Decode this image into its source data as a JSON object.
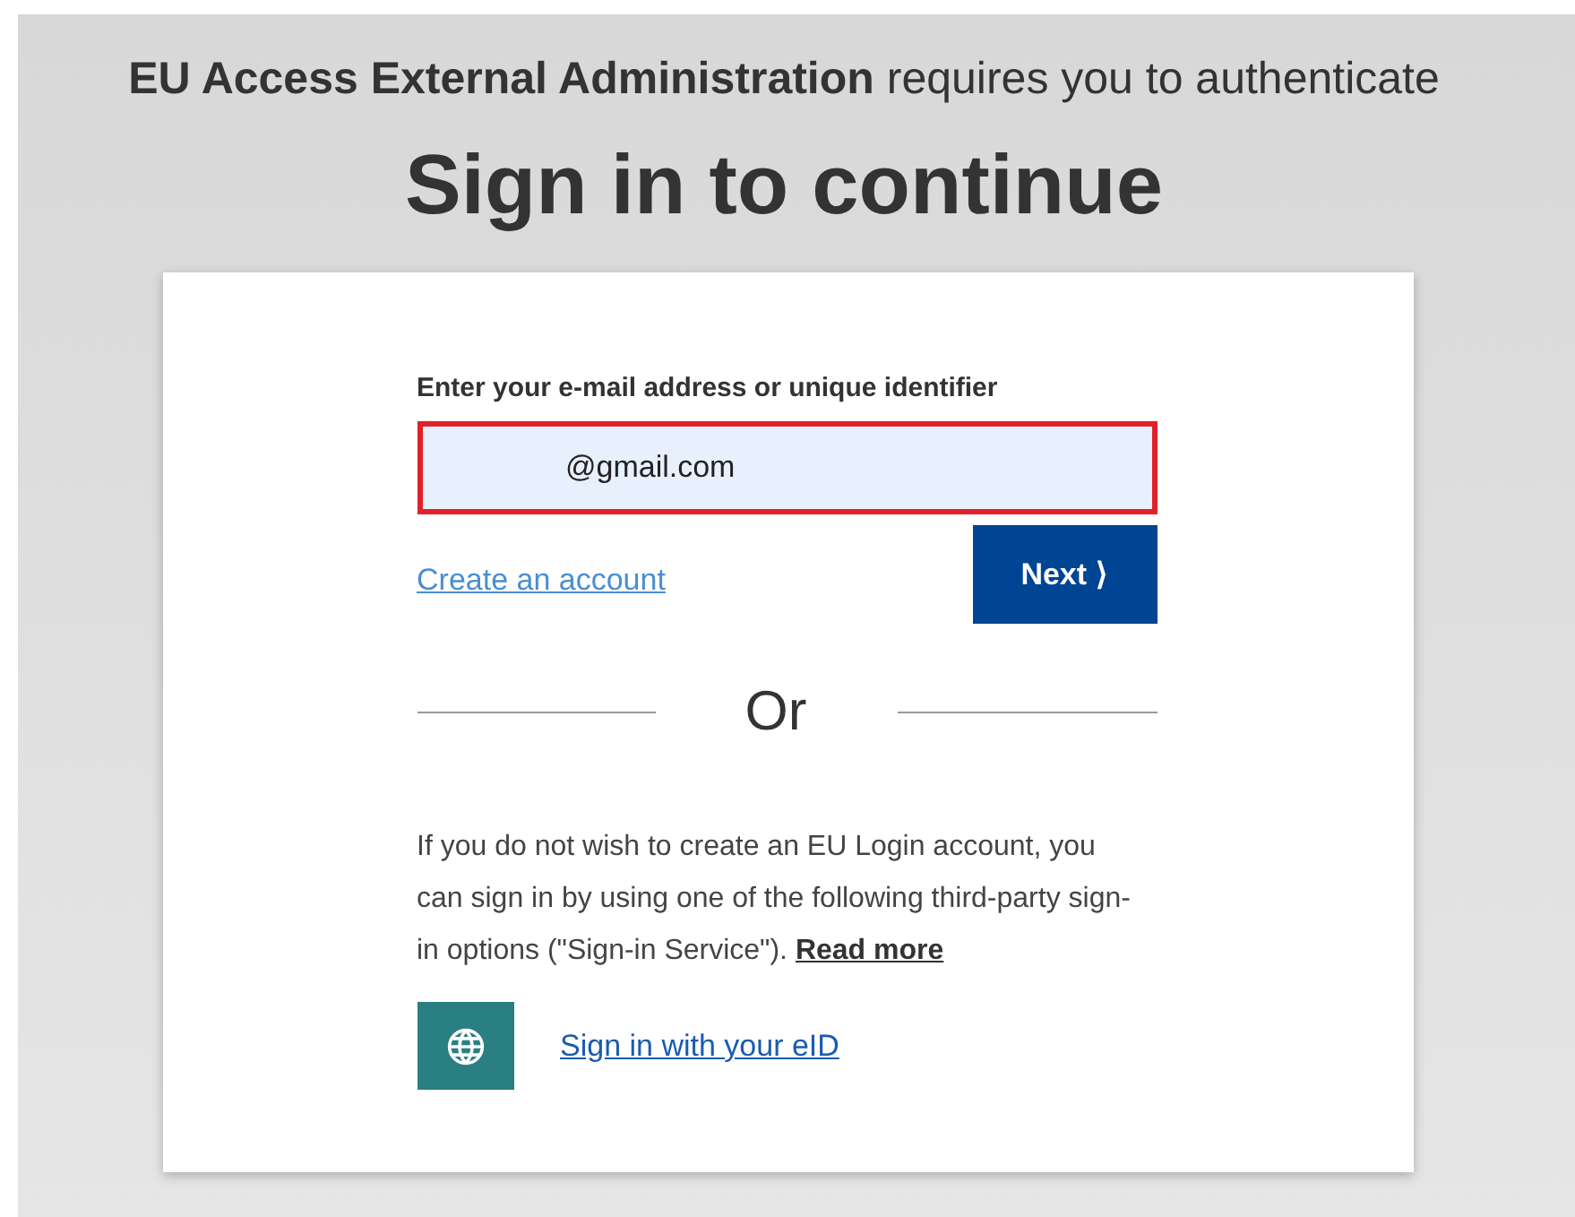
{
  "header": {
    "text": "**EU Access External Administration** requires you to authenticate"
  },
  "title": "Sign in to continue",
  "form": {
    "label": "Enter your e-mail address or unique identifier",
    "value": "@gmail.com",
    "highlighted": true
  },
  "create_account_link": "Create an account",
  "next_button": "Next ⟩",
  "divider_text": "Or",
  "info": {
    "text": "If you do not wish to create an EU Login account, you can sign in by using one of the following third-party sign-in options (\"Sign-in Service\"). ",
    "link": "Read more"
  },
  "eid_link": "Sign in with your eID"
}
